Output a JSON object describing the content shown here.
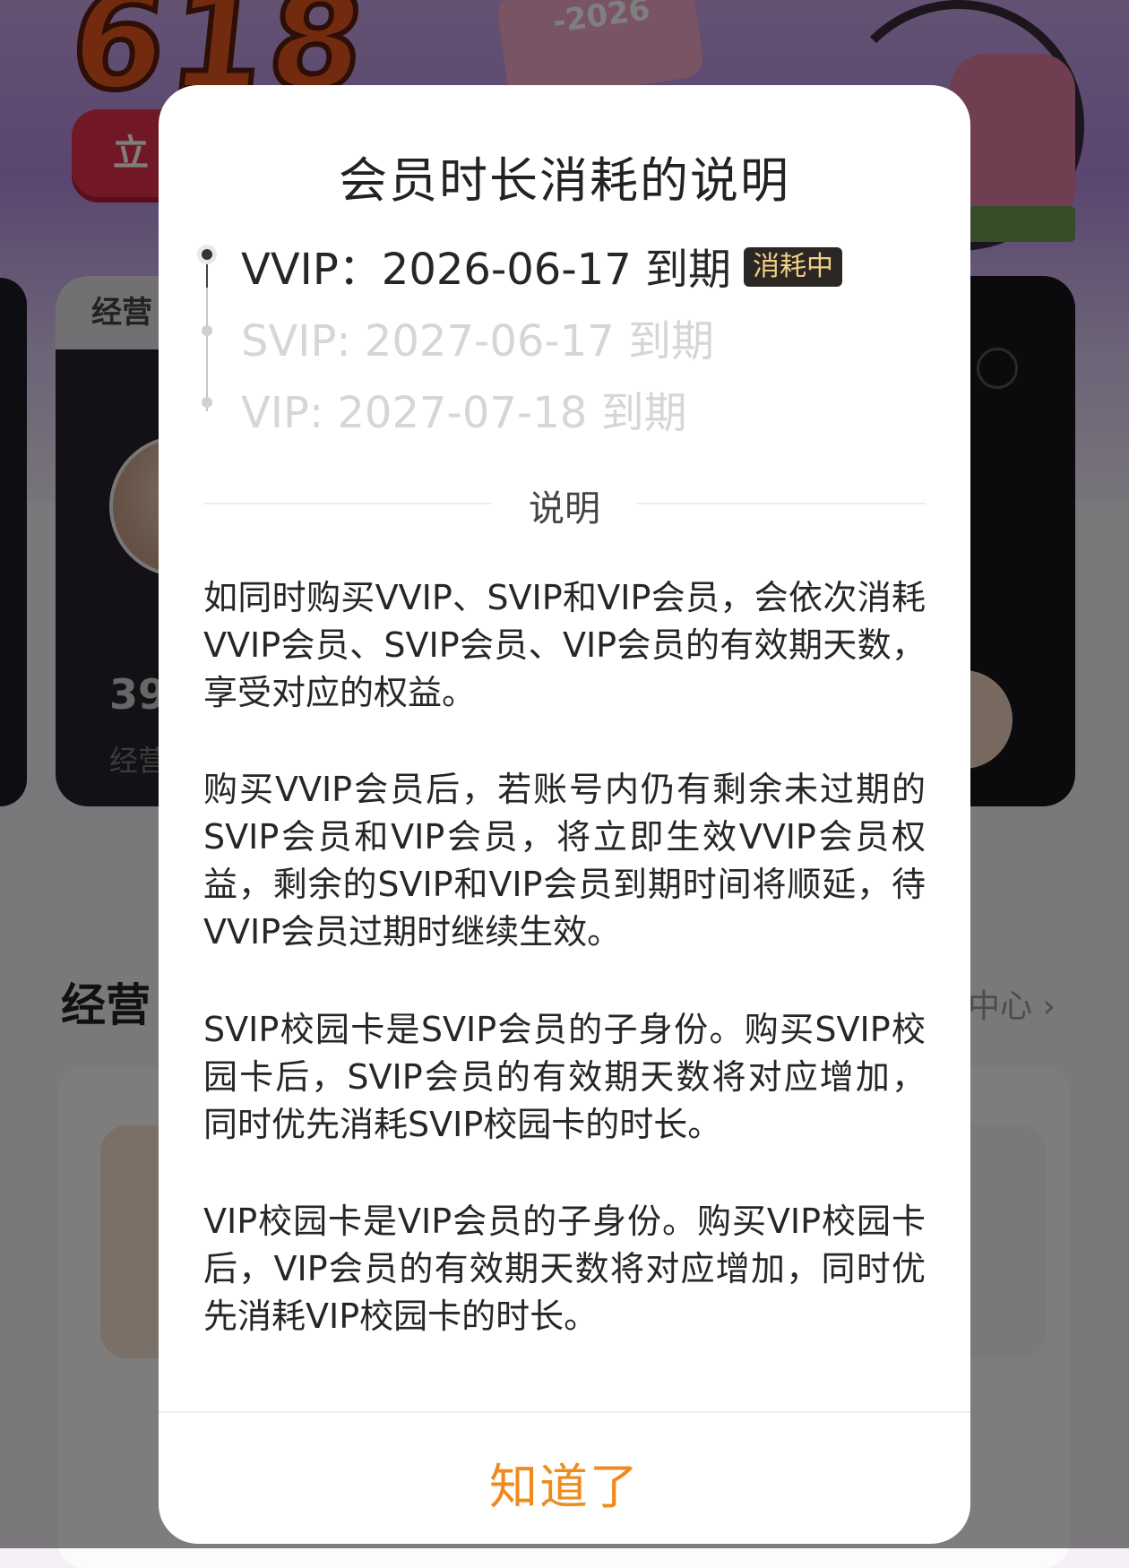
{
  "background": {
    "promo_number": "618",
    "promo_button": "立",
    "deco_year": "-2026",
    "card_tab": "经营",
    "card_number": "39",
    "card_caption": "经营",
    "section_title": "经营",
    "section_link": "中心 ›"
  },
  "modal": {
    "title": "会员时长消耗的说明",
    "timeline": [
      {
        "text": "VVIP：2026-06-17 到期",
        "badge": "消耗中",
        "state": "active"
      },
      {
        "text": "SVIP: 2027-06-17 到期",
        "state": "inactive"
      },
      {
        "text": "VIP: 2027-07-18 到期",
        "state": "inactive"
      }
    ],
    "section_label": "说明",
    "paragraphs": [
      "如同时购买VVIP、SVIP和VIP会员，会依次消耗VVIP会员、SVIP会员、VIP会员的有效期天数，享受对应的权益。",
      "购买VVIP会员后，若账号内仍有剩余未过期的SVIP会员和VIP会员，将立即生效VVIP会员权益，剩余的SVIP和VIP会员到期时间将顺延，待VVIP会员过期时继续生效。",
      "SVIP校园卡是SVIP会员的子身份。购买SVIP校园卡后，SVIP会员的有效期天数将对应增加，同时优先消耗SVIP校园卡的时长。",
      "VIP校园卡是VIP会员的子身份。购买VIP校园卡后，VIP会员的有效期天数将对应增加，同时优先消耗VIP校园卡的时长。"
    ],
    "ok_button": "知道了",
    "colors": {
      "accent": "#f08a1c",
      "badge_bg": "#2a2725",
      "badge_text": "#f3cf83"
    }
  }
}
